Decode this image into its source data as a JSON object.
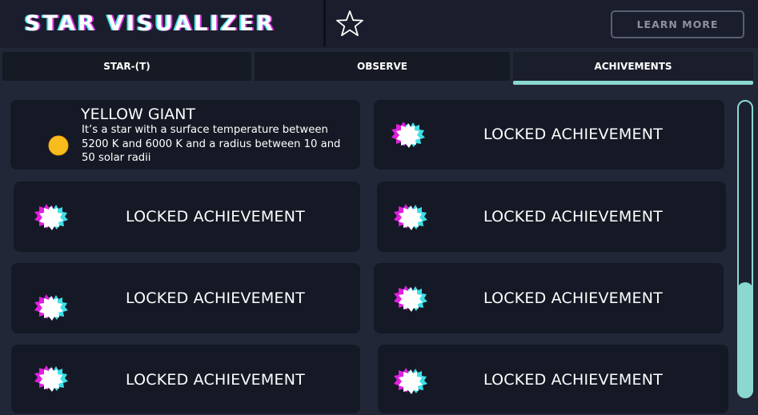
{
  "header": {
    "app_title": "STAR VISUALIZER",
    "learn_more_label": "LEARN MORE",
    "favorite_icon": "star-outline-icon"
  },
  "tabs": [
    {
      "label": "STAR-(T)",
      "active": false
    },
    {
      "label": "OBSERVE",
      "active": false
    },
    {
      "label": "ACHIVEMENTS",
      "active": true
    }
  ],
  "achievements": [
    {
      "unlocked": true,
      "icon": "sun-icon",
      "title": "YELLOW GIANT",
      "description": "It’s a star with a surface temperature between 5200 K and 6000 K and a radius between 10 and 50 solar radii"
    },
    {
      "unlocked": false,
      "icon": "locked-badge-icon",
      "label": "LOCKED ACHIEVEMENT"
    },
    {
      "unlocked": false,
      "icon": "locked-badge-icon",
      "label": "LOCKED ACHIEVEMENT"
    },
    {
      "unlocked": false,
      "icon": "locked-badge-icon",
      "label": "LOCKED ACHIEVEMENT"
    },
    {
      "unlocked": false,
      "icon": "locked-badge-icon",
      "label": "LOCKED ACHIEVEMENT"
    },
    {
      "unlocked": false,
      "icon": "locked-badge-icon",
      "label": "LOCKED ACHIEVEMENT"
    },
    {
      "unlocked": false,
      "icon": "locked-badge-icon",
      "label": "LOCKED ACHIEVEMENT"
    },
    {
      "unlocked": false,
      "icon": "locked-badge-icon",
      "label": "LOCKED ACHIEVEMENT"
    }
  ],
  "colors": {
    "background": "#212736",
    "header": "#1a1e2c",
    "card": "#151925",
    "accent_teal": "#8ad8d0",
    "badge_magenta": "#e020e0",
    "badge_cyan": "#3ee0e8",
    "sun_yellow": "#f8bd1c"
  }
}
